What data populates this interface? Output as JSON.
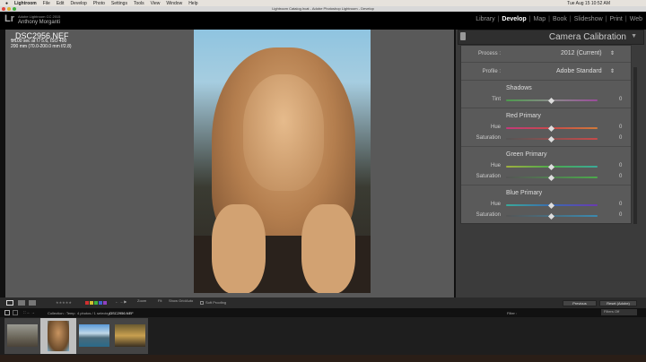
{
  "menubar": {
    "app": "Lightroom",
    "items": [
      "File",
      "Edit",
      "Develop",
      "Photo",
      "Settings",
      "Tools",
      "View",
      "Window",
      "Help"
    ],
    "clock": "Tue Aug 15  10:52 AM"
  },
  "window": {
    "title": "Lightroom Catalog.lrcat - Adobe Photoshop Lightroom - Develop"
  },
  "identity": {
    "logo": "Lr",
    "line1": "Adobe Lightroom CC 2015",
    "name": "Anthony Morganti"
  },
  "modules": [
    {
      "label": "Library"
    },
    {
      "label": "Develop",
      "active": true
    },
    {
      "label": "Map"
    },
    {
      "label": "Book"
    },
    {
      "label": "Slideshow"
    },
    {
      "label": "Print"
    },
    {
      "label": "Web"
    }
  ],
  "photo_info": {
    "filename": "_DSC2956.NEF",
    "exposure": "1/100 sec at f / 5.6, ISO 400",
    "lens": "200 mm (70.0-200.0 mm f/2.8)"
  },
  "panel": {
    "title": "Camera Calibration",
    "process_label": "Process :",
    "process_value": "2012 (Current)",
    "profile_label": "Profile :",
    "profile_value": "Adobe Standard",
    "sections": [
      {
        "title": "Shadows",
        "sliders": [
          {
            "label": "Tint",
            "value": "0",
            "gradient": "linear-gradient(90deg,#4c9a4c,#8a8a8a,#9a4c9a)"
          }
        ]
      },
      {
        "title": "Red Primary",
        "sliders": [
          {
            "label": "Hue",
            "value": "0",
            "gradient": "linear-gradient(90deg,#c23a7a,#c84a4a,#d07a3a)"
          },
          {
            "label": "Saturation",
            "value": "0",
            "gradient": "linear-gradient(90deg,#555,#c84a4a)"
          }
        ]
      },
      {
        "title": "Green Primary",
        "sliders": [
          {
            "label": "Hue",
            "value": "0",
            "gradient": "linear-gradient(90deg,#a0b040,#4caa4c,#3aaa9a)"
          },
          {
            "label": "Saturation",
            "value": "0",
            "gradient": "linear-gradient(90deg,#555,#4caa4c)"
          }
        ]
      },
      {
        "title": "Blue Primary",
        "sliders": [
          {
            "label": "Hue",
            "value": "0",
            "gradient": "linear-gradient(90deg,#3aaa9a,#3a6ab0,#6a3ab0)"
          },
          {
            "label": "Saturation",
            "value": "0",
            "gradient": "linear-gradient(90deg,#555,#3a8ab0)"
          }
        ]
      }
    ]
  },
  "toolbar": {
    "zoom_label": "Zoom",
    "zoom_value": "Fit",
    "grid_label": "Show Grid",
    "grid_value": "Auto",
    "soft_proofing": "Soft Proofing",
    "previous": "Previous",
    "reset": "Reset (Adobe)"
  },
  "filmstrip": {
    "source": "Collection : Temp",
    "count": "4 photos / 1 selected /",
    "selected": "_DSC2956.NEF",
    "filter_label": "Filter :",
    "filter_value": "Filters Off",
    "thumbs": [
      {
        "bg": "linear-gradient(180deg,#9a9a92,#6a6558 60%,#4a4238)"
      },
      {
        "bg": "radial-gradient(ellipse at 50% 40%,#c89460,#6a4a2a 70%,#7ab0d0)",
        "selected": true
      },
      {
        "bg": "linear-gradient(180deg,#5a9ad8,#c0d8e8 40%,#4a6a7a 60%,#2a6a8a)"
      },
      {
        "bg": "linear-gradient(180deg,#6a5a30,#c8a050 50%,#3a3020)"
      }
    ]
  }
}
